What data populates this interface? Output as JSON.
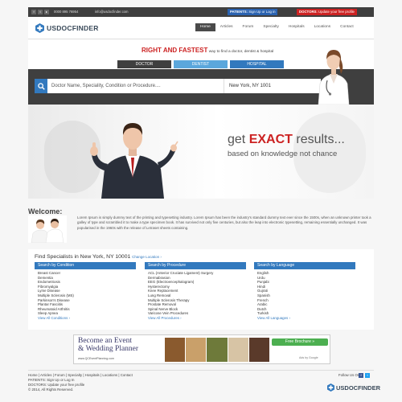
{
  "topbar": {
    "phone": "0000 895 76954",
    "email": "info@usdocfinder.com",
    "patients_label": "PATIENTS:",
    "patients_link": "Sign Up or Log in",
    "doctors_label": "DOCTORS:",
    "doctors_link": "Update your free profile"
  },
  "brand": {
    "name": "USDOCFINDER"
  },
  "nav": {
    "items": [
      "Home",
      "Articles",
      "Forum",
      "Specialty",
      "Hospitals",
      "Locations",
      "Contact"
    ]
  },
  "hero": {
    "headline_red": "RIGHT AND FASTEST",
    "headline_rest": " way to find a doctor, dentist & hospital",
    "tabs": [
      "DOCTOR",
      "DENTIST",
      "HOSPITAL"
    ]
  },
  "search": {
    "placeholder": "Doctor Name, Speciality, Condition or Procedure....",
    "location": "New York, NY 1001"
  },
  "banner": {
    "line1_a": "get ",
    "line1_red": "EXACT",
    "line1_b": " results...",
    "line2": "based on knowledge not chance"
  },
  "welcome": {
    "title": "Welcome:",
    "text": "Lorem Ipsum is simply dummy text of the printing and typesetting industry. Lorem Ipsum has been the industry's standard dummy text ever since the 1500s, when an unknown printer took a galley of type and scrambled it to make a type specimen book. It has survived not only five centuries, but also the leap into electronic typesetting, remaining essentially unchanged. It was popularised in the 1960s with the release of Letraset sheets containing."
  },
  "find": {
    "title": "Find Specialists in New York, NY 10001",
    "change": "Change Location ›",
    "columns": [
      {
        "header": "Search by Condition",
        "items": [
          "Breast Cancer",
          "Dementia",
          "Endometriosis",
          "Fibromyalgia",
          "Lyme Disease",
          "Multiple Sclerosis (MS)",
          "Parkinson's Disease",
          "Plantar Fasciitis",
          "Rheumatoid Arthritis",
          "Sleep Apnea"
        ],
        "more": "View All Conditions ›"
      },
      {
        "header": "Search by Procedure",
        "items": [
          "ACL (Anterior Cruciate Ligament) Surgery",
          "Dermabrasion",
          "EEG (Electroencephalogram)",
          "Hysterectomy",
          "Knee Replacement",
          "Lung Removal",
          "Multiple Sclerosis Therapy",
          "Prostate Removal",
          "Spinal Nerve Block",
          "Varicose Vein Procedures"
        ],
        "more": "View All Procedures ›"
      },
      {
        "header": "Search by Language",
        "items": [
          "English",
          "Urdu",
          "Punjabi",
          "Hindi",
          "Gujrati",
          "Spanish",
          "French",
          "Arabic",
          "Dutch",
          "Turkish"
        ],
        "more": "View All Languages ›"
      }
    ]
  },
  "ad": {
    "line1": "Become an Event",
    "line2": "& Wedding Planner",
    "url": "www.QCEventPlanning.com",
    "cta": "Free Brochure »",
    "adsby": "Ads by Google"
  },
  "footer": {
    "links": "Home | Articles | Forum | Specialty | Hospitals | Locations | Contact",
    "patients": "PATIENTS: Sign Up or Log In",
    "doctors": "DOCTORS: Update your free profile",
    "copyright": "© 2014, All Rights Reserved.",
    "follow": "Follow Us On:"
  },
  "colors": {
    "accent_blue": "#3279be",
    "tab_blue": "#5ba7dc",
    "dark_bar": "#3f3f3f",
    "red": "#cc2222",
    "patients_bg": "#2a62b0",
    "doctors_bg": "#cc2222"
  }
}
